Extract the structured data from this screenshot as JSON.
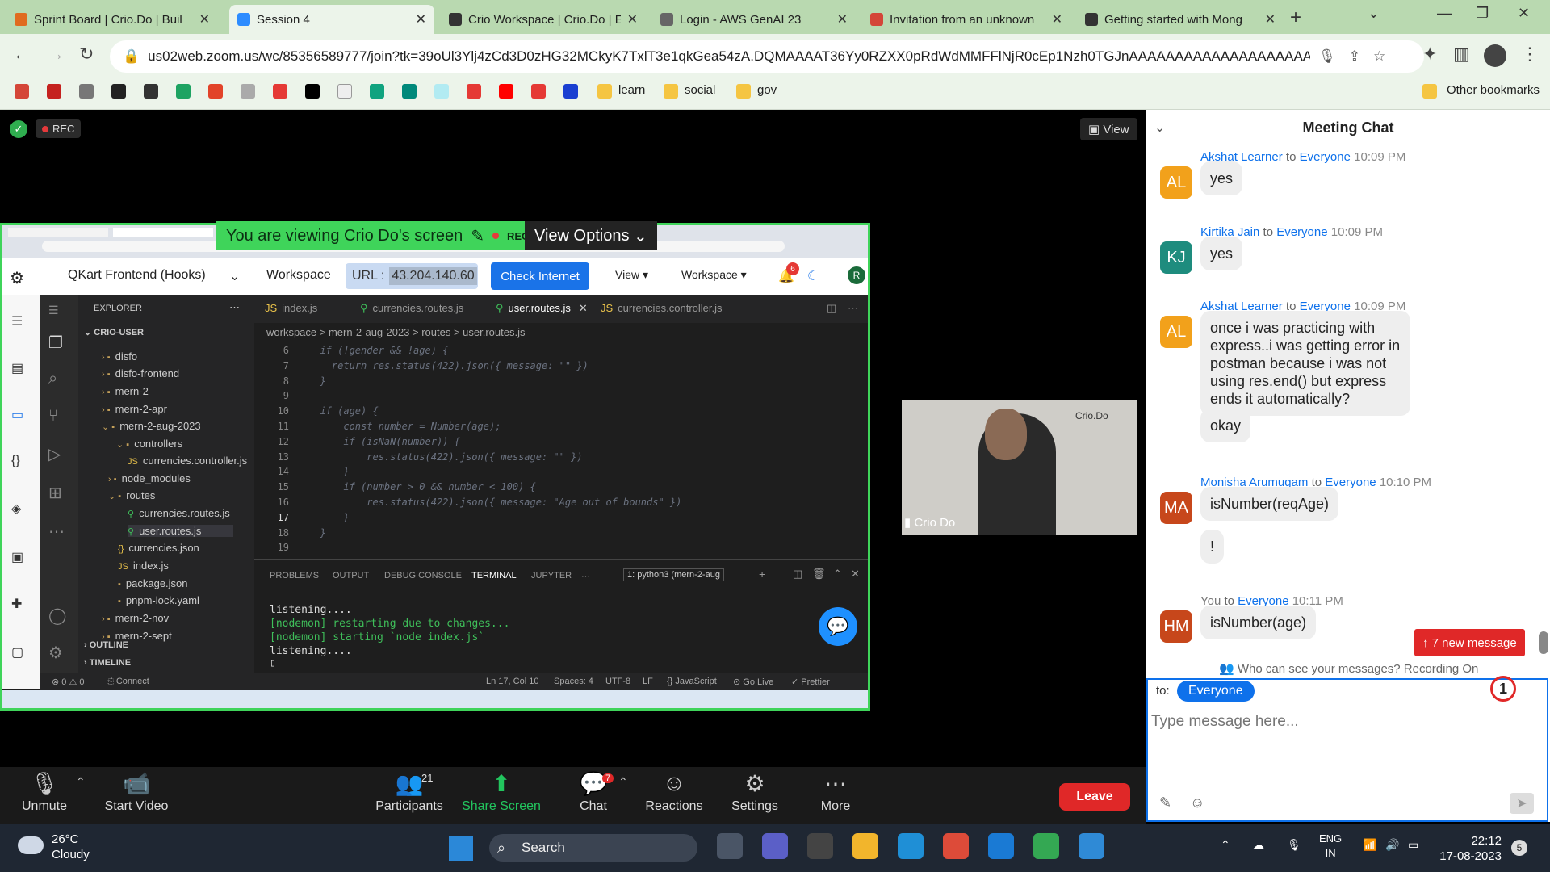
{
  "browser": {
    "tabs": [
      {
        "title": "Sprint Board | Crio.Do | Buil",
        "color": "#e06b1f"
      },
      {
        "title": "Session 4",
        "color": "#2d8cff"
      },
      {
        "title": "Crio Workspace | Crio.Do | E",
        "color": "#333333"
      },
      {
        "title": "Login - AWS GenAI 23",
        "color": "#666666"
      },
      {
        "title": "Invitation from an unknown",
        "color": "#d44638"
      },
      {
        "title": "Getting started with Mong",
        "color": "#333333"
      }
    ],
    "url": "us02web.zoom.us/wc/85356589777/join?tk=39oUl3Ylj4zCd3D0zHG32MCkyK7TxlT3e1qkGea54zA.DQMAAAAT36Yy0RZXX0pRdWdMMFFlNjR0cEp1Nzh0TGJnAAAAAAAAAAAAAAAAAAAA...",
    "bookmark_folders": [
      "learn",
      "social",
      "gov"
    ],
    "other_bookmarks": "Other bookmarks"
  },
  "zoom": {
    "rec_label": "REC",
    "view_label": "View",
    "share_banner": "You are viewing Crio Do's screen",
    "share_rec": "REC",
    "view_options": "View Options",
    "video_name": "Crio Do",
    "video_logo": "Crio.Do",
    "toolbar": [
      {
        "label": "Unmute",
        "icon": "mic-muted-icon"
      },
      {
        "label": "Start Video",
        "icon": "video-off-icon"
      },
      {
        "label": "Participants",
        "icon": "participants-icon",
        "count": "21"
      },
      {
        "label": "Share Screen",
        "icon": "share-icon"
      },
      {
        "label": "Chat",
        "icon": "chat-icon",
        "count": "7"
      },
      {
        "label": "Reactions",
        "icon": "reaction-icon"
      },
      {
        "label": "Settings",
        "icon": "gear-icon"
      },
      {
        "label": "More",
        "icon": "more-icon"
      }
    ],
    "leave_label": "Leave"
  },
  "crio": {
    "project": "QKart Frontend (Hooks)",
    "workspace": "Workspace",
    "url_label": "URL :",
    "url_value": "43.204.140.60",
    "check_internet": "Check Internet",
    "view_menu": "View",
    "workspace_menu": "Workspace",
    "notif_count": "6",
    "avatar": "R"
  },
  "vscode": {
    "explorer_title": "EXPLORER",
    "root": "CRIO-USER",
    "tree": [
      "disfo",
      "disfo-frontend",
      "mern-2",
      "mern-2-apr",
      "mern-2-aug-2023",
      "controllers",
      "currencies.controller.js",
      "node_modules",
      "routes",
      "currencies.routes.js",
      "user.routes.js",
      "currencies.json",
      "index.js",
      "package.json",
      "pnpm-lock.yaml",
      "mern-2-nov",
      "mern-2-sept"
    ],
    "outline": "OUTLINE",
    "timeline": "TIMELINE",
    "tabs": [
      "index.js",
      "currencies.routes.js",
      "user.routes.js",
      "currencies.controller.js"
    ],
    "breadcrumb": "workspace > mern-2-aug-2023 > routes > user.routes.js",
    "lines": [
      {
        "n": "6",
        "t": "  if (!gender && !age) {"
      },
      {
        "n": "7",
        "t": "    return res.status(422).json({ message: \"\" })"
      },
      {
        "n": "8",
        "t": "  }"
      },
      {
        "n": "9",
        "t": ""
      },
      {
        "n": "10",
        "t": "  if (age) {"
      },
      {
        "n": "11",
        "t": "      const number = Number(age);"
      },
      {
        "n": "12",
        "t": "      if (isNaN(number)) {"
      },
      {
        "n": "13",
        "t": "          res.status(422).json({ message: \"\" })"
      },
      {
        "n": "14",
        "t": "      }"
      },
      {
        "n": "15",
        "t": "      if (number > 0 && number < 100) {"
      },
      {
        "n": "16",
        "t": "          res.status(422).json({ message: \"Age out of bounds\" })"
      },
      {
        "n": "17",
        "t": "      }"
      },
      {
        "n": "18",
        "t": "  }"
      },
      {
        "n": "19",
        "t": ""
      }
    ],
    "panel_tabs": [
      "PROBLEMS",
      "OUTPUT",
      "DEBUG CONSOLE",
      "TERMINAL",
      "JUPYTER"
    ],
    "terminal_select": "1: python3 (mern-2-aug",
    "terminal": [
      {
        "t": "listening....",
        "c": "#dddddd"
      },
      {
        "t": "[nodemon] restarting due to changes...",
        "c": "#3fbf5a"
      },
      {
        "t": "[nodemon] starting `node index.js`",
        "c": "#3fbf5a"
      },
      {
        "t": "listening....",
        "c": "#dddddd"
      }
    ],
    "status": {
      "errors": "⊗ 0 ⚠ 0",
      "connect": "Connect",
      "pos": "Ln 17, Col 10",
      "spaces": "Spaces: 4",
      "enc": "UTF-8",
      "eol": "LF",
      "lang": "JavaScript",
      "golive": "Go Live",
      "prettier": "Prettier"
    }
  },
  "chat": {
    "title": "Meeting Chat",
    "messages": [
      {
        "sender": "Akshat Learner",
        "to": "to",
        "target": "Everyone",
        "time": "10:09 PM",
        "initials": "AL",
        "color": "#f2a11b",
        "texts": [
          "yes"
        ]
      },
      {
        "sender": "Kirtika Jain",
        "to": "to",
        "target": "Everyone",
        "time": "10:09 PM",
        "initials": "KJ",
        "color": "#1e8c7e",
        "texts": [
          "yes"
        ]
      },
      {
        "sender": "Akshat Learner",
        "to": "to",
        "target": "Everyone",
        "time": "10:09 PM",
        "initials": "AL",
        "color": "#f2a11b",
        "texts": [
          "once i was practicing with express..i was getting error in postman because i was not using res.end() but express ends it automatically?",
          "okay"
        ]
      },
      {
        "sender": "Monisha Arumugam",
        "to": "to",
        "target": "Everyone",
        "time": "10:10 PM",
        "initials": "MA",
        "color": "#c7471b",
        "texts": [
          "isNumber(reqAge)",
          "!"
        ]
      },
      {
        "sender": "You",
        "to": "to",
        "target": "Everyone",
        "time": "10:11 PM",
        "initials": "HM",
        "color": "#c7471b",
        "texts": [
          "isNumber(age)"
        ]
      }
    ],
    "new_messages": "↑ 7 new message",
    "who_can_see": "Who can see your messages? Recording On",
    "to_label": "to:",
    "to_target": "Everyone",
    "placeholder": "Type message here...",
    "unread_badge": "1"
  },
  "taskbar": {
    "temp": "26°C",
    "condition": "Cloudy",
    "search": "Search",
    "lang1": "ENG",
    "lang2": "IN",
    "time": "22:12",
    "date": "17-08-2023",
    "notif": "5"
  }
}
